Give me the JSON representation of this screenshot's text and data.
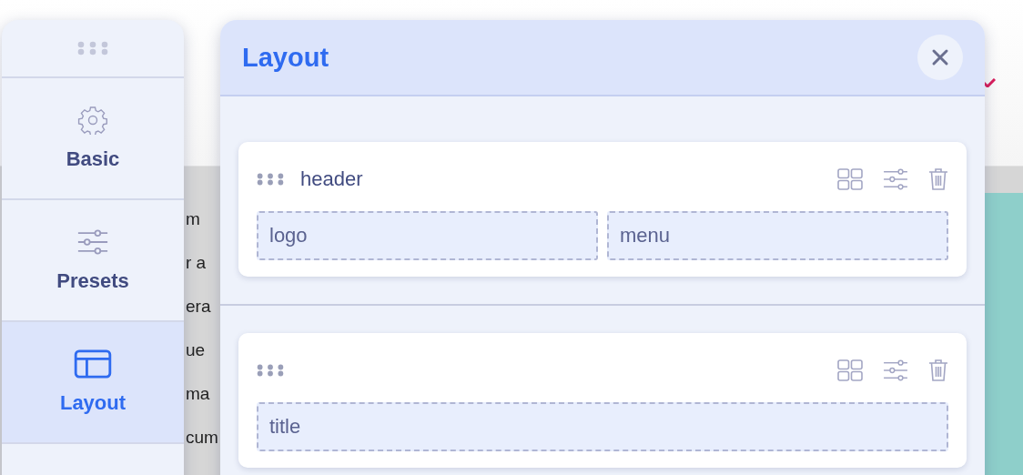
{
  "page": {
    "text_lines": [
      "m",
      "r a",
      "era",
      "ue",
      "ma",
      "cum"
    ]
  },
  "sidebar": {
    "items": [
      {
        "kind": "gear",
        "label": "Basic",
        "selected": false
      },
      {
        "kind": "sliders",
        "label": "Presets",
        "selected": false
      },
      {
        "kind": "layout",
        "label": "Layout",
        "selected": true
      }
    ]
  },
  "panel": {
    "title": "Layout",
    "sections": [
      {
        "name": "header",
        "slots": [
          "logo",
          "menu"
        ]
      },
      {
        "slots": [
          "title"
        ]
      }
    ]
  }
}
